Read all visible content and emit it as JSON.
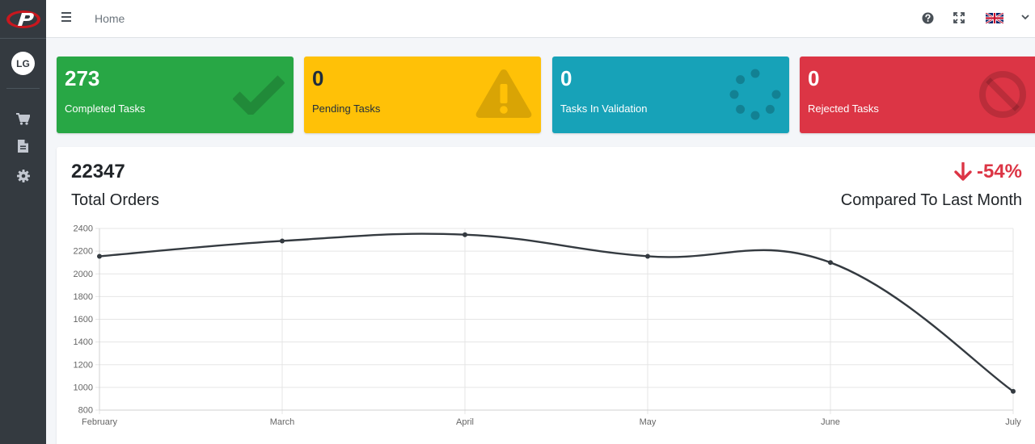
{
  "navbar": {
    "home_label": "Home"
  },
  "sidebar": {
    "user_initials": "LG"
  },
  "cards": [
    {
      "value": "273",
      "label": "Completed Tasks",
      "color": "#28a745",
      "icon": "check-icon"
    },
    {
      "value": "0",
      "label": "Pending Tasks",
      "color": "#ffc107",
      "icon": "warning-icon"
    },
    {
      "value": "0",
      "label": "Tasks In Validation",
      "color": "#17a2b8",
      "icon": "spinner-icon"
    },
    {
      "value": "0",
      "label": "Rejected Tasks",
      "color": "#dc3545",
      "icon": "ban-icon"
    }
  ],
  "orders": {
    "total": "22347",
    "total_label": "Total Orders",
    "change": "-54%",
    "change_label": "Compared To Last Month"
  },
  "chart_data": {
    "type": "line",
    "categories": [
      "February",
      "March",
      "April",
      "May",
      "June",
      "July"
    ],
    "values": [
      2155,
      2290,
      2345,
      2155,
      2100,
      965
    ],
    "ylim": [
      800,
      2400
    ],
    "yticks": [
      800,
      1000,
      1200,
      1400,
      1600,
      1800,
      2000,
      2200,
      2400
    ],
    "grid": true,
    "line_color": "#343a40"
  }
}
